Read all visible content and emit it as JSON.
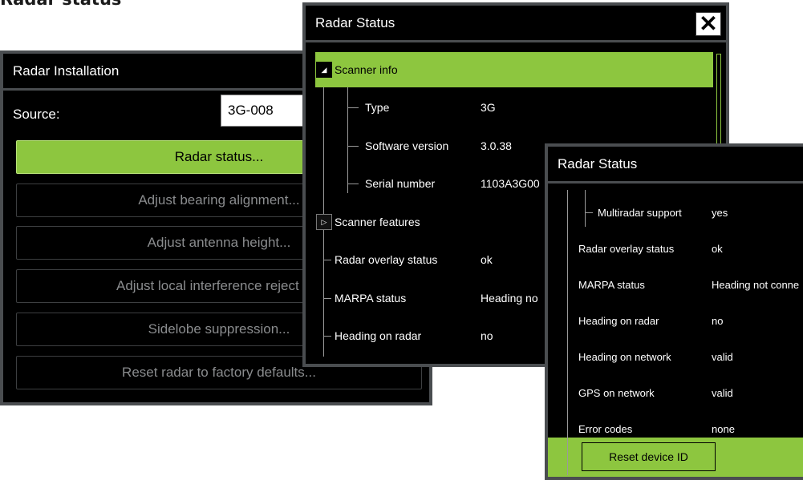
{
  "page_heading": "Radar status",
  "installation": {
    "title": "Radar Installation",
    "source_label": "Source:",
    "source_value": "3G-008",
    "buttons": [
      "Radar status...",
      "Adjust bearing alignment...",
      "Adjust antenna height...",
      "Adjust local interference reject",
      "Sidelobe suppression...",
      "Reset radar to factory defaults..."
    ]
  },
  "status1": {
    "title": "Radar Status",
    "close_glyph": "✕",
    "scanner_info": "Scanner info",
    "rows": [
      {
        "label": "Type",
        "value": "3G"
      },
      {
        "label": "Software version",
        "value": "3.0.38"
      },
      {
        "label": "Serial number",
        "value": "1103A3G00"
      }
    ],
    "scanner_features": "Scanner features",
    "rows2": [
      {
        "label": "Radar overlay status",
        "value": "ok"
      },
      {
        "label": "MARPA status",
        "value": "Heading no"
      },
      {
        "label": "Heading on radar",
        "value": "no"
      }
    ]
  },
  "status2": {
    "title": "Radar Status",
    "rows": [
      {
        "label": "Multiradar support",
        "value": "yes"
      },
      {
        "label": "Radar overlay status",
        "value": "ok"
      },
      {
        "label": "MARPA status",
        "value": "Heading not conne"
      },
      {
        "label": "Heading on radar",
        "value": "no"
      },
      {
        "label": "Heading on network",
        "value": "valid"
      },
      {
        "label": "GPS on network",
        "value": "valid"
      },
      {
        "label": "Error codes",
        "value": "none"
      }
    ],
    "reset_label": "Reset device ID"
  },
  "colors": {
    "accent": "#8dc63f",
    "frame": "#4a4d50",
    "background": "#000000"
  },
  "icons": {
    "close": "close-icon",
    "expanded": "triangle-expanded-icon",
    "collapsed": "triangle-collapsed-icon"
  }
}
